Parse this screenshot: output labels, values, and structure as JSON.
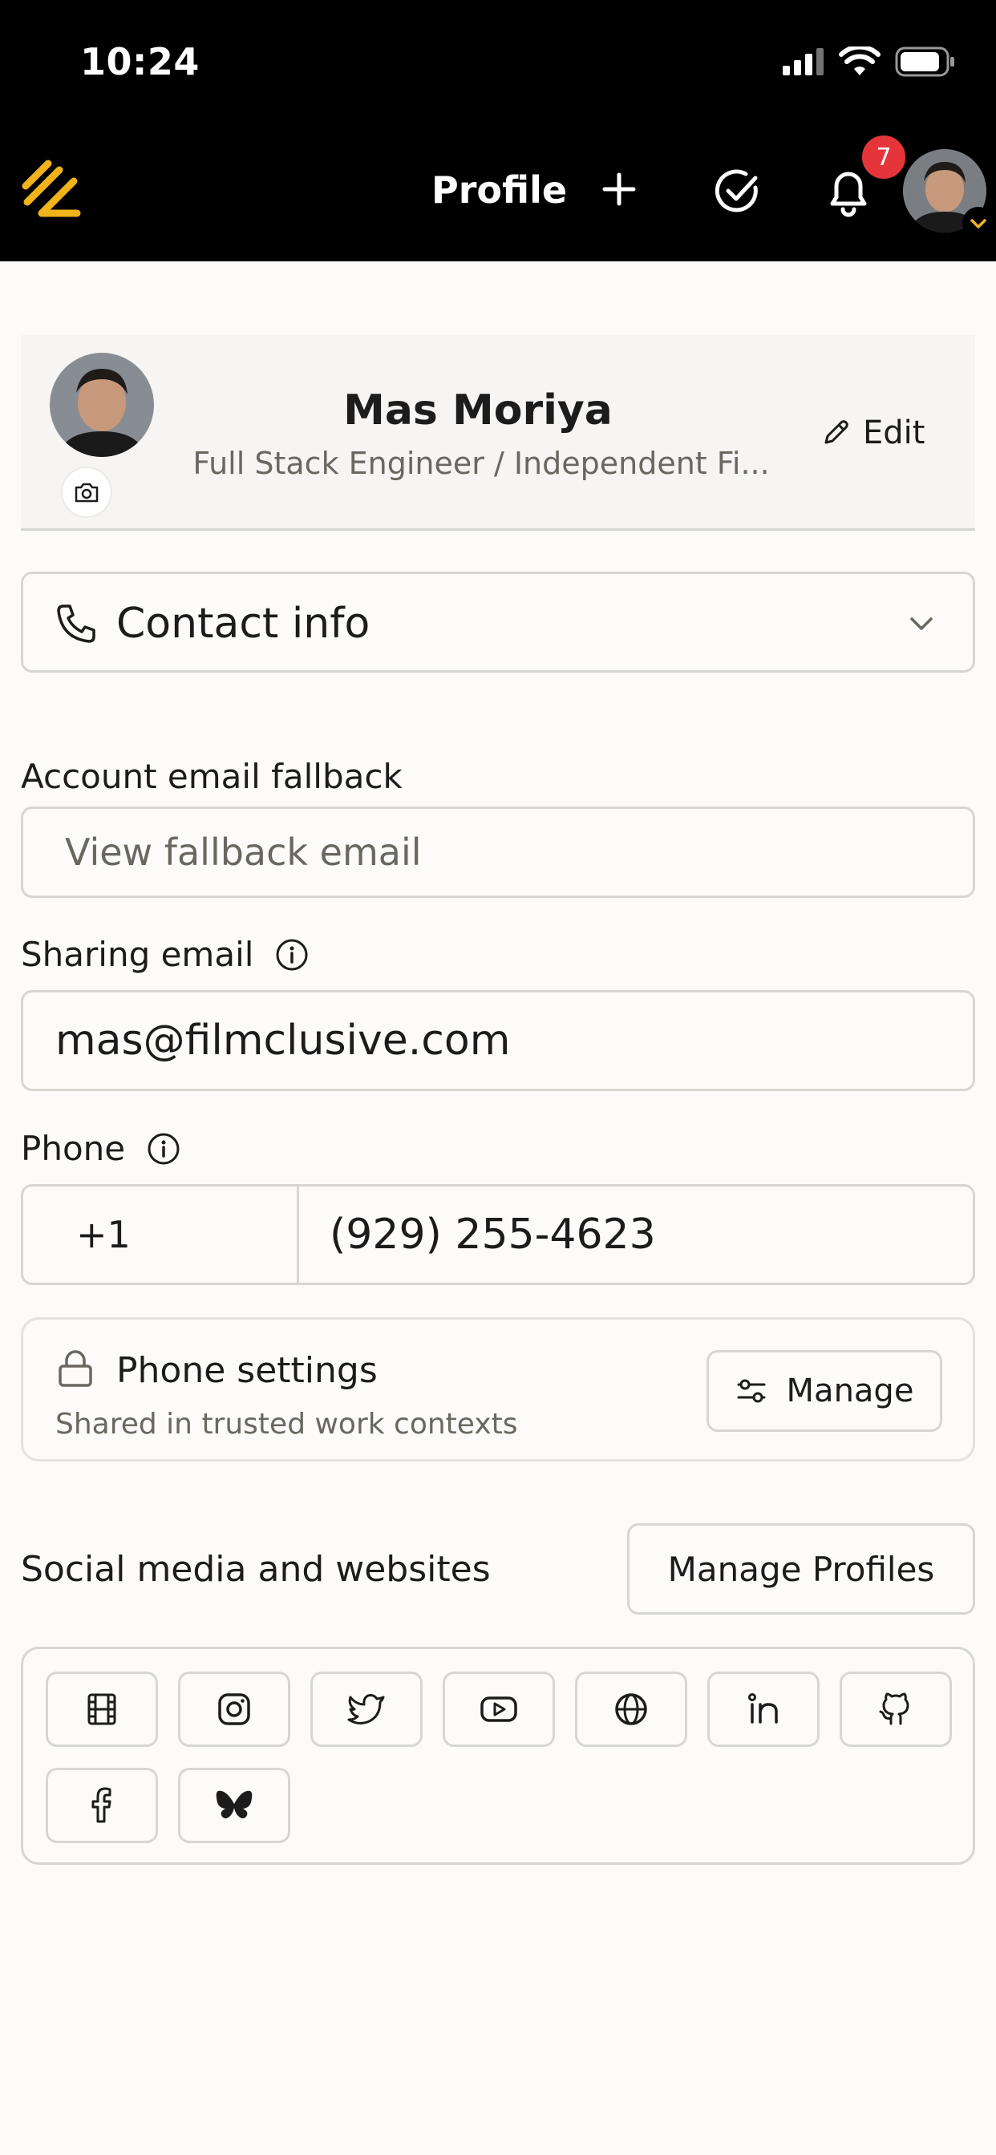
{
  "status_bar": {
    "time": "10:24"
  },
  "header": {
    "title": "Profile",
    "notification_count": "7",
    "accent_color": "#f0b31b",
    "badge_color": "#e5353b"
  },
  "profile": {
    "name": "Mas Moriya",
    "headline": "Full Stack Engineer / Independent Fi...",
    "edit_label": "Edit"
  },
  "contact": {
    "label": "Contact info"
  },
  "fallback_email": {
    "label": "Account email fallback",
    "button_label": "View fallback email"
  },
  "sharing_email": {
    "label": "Sharing email",
    "value": "mas@filmclusive.com"
  },
  "phone": {
    "label": "Phone",
    "country_code": "+1",
    "number": "(929) 255-4623"
  },
  "phone_settings": {
    "title": "Phone settings",
    "subtitle": "Shared in trusted work contexts",
    "manage_label": "Manage"
  },
  "social": {
    "heading": "Social media and websites",
    "manage_profiles_label": "Manage Profiles",
    "icons": [
      "film-icon",
      "instagram-icon",
      "twitter-icon",
      "youtube-icon",
      "globe-icon",
      "linkedin-icon",
      "github-icon",
      "facebook-icon",
      "bluesky-icon"
    ]
  }
}
